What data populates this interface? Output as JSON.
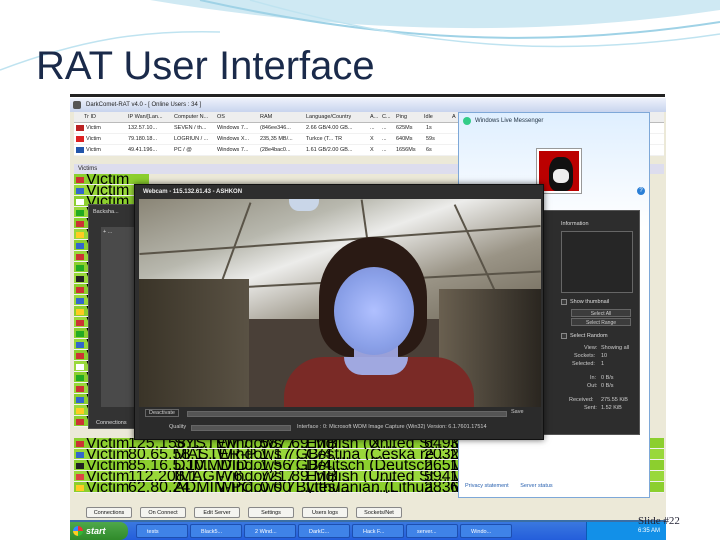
{
  "slide": {
    "title": "RAT User  Interface",
    "slide_number": "Slide #22"
  },
  "darkcomet": {
    "title": "DarkComet-RAT v4.0 - [ Online Users : 34 ]",
    "columns": [
      "Tr ID",
      "IP Wan/[Lan...",
      "Computer N...",
      "OS",
      "RAM",
      "Language/Country",
      "A...",
      "C...",
      "Ping",
      "Idle",
      "A"
    ],
    "top_rows": [
      {
        "id": "Victim",
        "ip": "132.57.10...",
        "pc": "SEVEN / th...",
        "os": "Windows 7...",
        "ram": "(846ee346...",
        "lang": "2.66 GB/4.00 GB...",
        "a": "...",
        "c": "...",
        "ping": "625Ms",
        "idle": "1s",
        "flag": "#b22"
      },
      {
        "id": "Victim",
        "ip": "79.180.18...",
        "pc": "LOGRIUN / ...",
        "os": "Windows X...",
        "ram": "235,35 MB/...",
        "lang": "Turkce (T... TR",
        "a": "X",
        "c": "...",
        "ping": "640Ms",
        "idle": "59s",
        "flag": "#d22"
      },
      {
        "id": "Victim",
        "ip": "49.41.196...",
        "pc": "PC / @",
        "os": "Windows 7...",
        "ram": "(28e4bac0...",
        "lang": "1.61 GB/2.00 GB...",
        "a": "X",
        "c": "...",
        "ping": "1656Ms",
        "idle": "6s",
        "flag": "#25a"
      }
    ],
    "victims_label": "Victims",
    "green_rows": [
      "Victim",
      "Victim",
      "Victim",
      "Victim",
      "Victim",
      "Victim",
      "Victim",
      "Victim",
      "Victim",
      "Victim",
      "Victim",
      "Victim",
      "Victim",
      "Victim",
      "Victim",
      "Victim",
      "Victim",
      "Victim",
      "Victim",
      "Victim",
      "Victim",
      "Victim",
      "Victim"
    ],
    "lower_rows": [
      {
        "id": "Victim",
        "ip": "125.158.1...",
        "pc": "SYSTEM / ...",
        "os": "Windows 7...",
        "ram": "587.69 MB...",
        "lang": "English (United St...",
        "a": "X",
        "c": "...",
        "ping": "649Ms",
        "idle": "3s"
      },
      {
        "id": "Victim",
        "ip": "80.65.58.1...",
        "pc": "MASTER-P...",
        "os": "Windows 7...",
        "ram": "1,17 GB/4,...",
        "lang": "Čeština (Česká re...",
        "a": "...",
        "c": "...",
        "ping": "203Ms",
        "idle": "2s"
      },
      {
        "id": "Victim",
        "ip": "85.16.5.10...",
        "pc": "DJMMDID...",
        "os": "Windows 7...",
        "ram": "1,56 GB/4,...",
        "lang": "Deutsch (Deutsch...",
        "a": "...",
        "c": "...",
        "ping": "265Ms",
        "idle": "1613s"
      },
      {
        "id": "Victim",
        "ip": "112.208.1...",
        "pc": "IMAGI-76...",
        "os": "Windows 7...",
        "ram": "721.89 MB...",
        "lang": "English (United St...",
        "a": "...",
        "c": "...",
        "ping": "594Ms",
        "idle": "11s"
      },
      {
        "id": "Victim",
        "ip": "62.80.24...",
        "pc": "ADMIN-PC...",
        "os": "Windows 7...",
        "ram": "0.00 Bytes/...",
        "lang": "Lithuanian (Lithua...",
        "a": "...",
        "c": "...",
        "ping": "283Ms",
        "idle": "6s"
      }
    ],
    "buttons": [
      "Connections",
      "On Connect",
      "Edit Server",
      "Settings",
      "Users logs",
      "Sockets/Net"
    ]
  },
  "backshell": {
    "title": "Backsha...",
    "tree_item": "+ ...",
    "connections_label": "Connections"
  },
  "webcam": {
    "title": "Webcam - 115.132.61.43 - ASHKON",
    "deactivate_label": "Deactivate",
    "quality_label": "Quality",
    "save_label": "Save",
    "interface_text": "Interface : 0: Microsoft WDM Image Capture (Win32) Version: 6.1.7601.17514"
  },
  "messenger": {
    "title": "Windows Live Messenger",
    "help": "?",
    "footer": [
      "Privacy statement",
      "Server status"
    ]
  },
  "panel": {
    "information_label": "Information",
    "show_thumbnail": "Show thumbnail",
    "select_all": "Select All",
    "select_range": "Select Range",
    "select_random": "Select Random",
    "view_label": "View:",
    "view_value": "Showing all",
    "sockets_label": "Sockets:",
    "sockets_value": "10",
    "selected_label": "Selected:",
    "selected_value": "1",
    "in_label": "In:",
    "in_value": "0 B/s",
    "out_label": "Out:",
    "out_value": "0 B/s",
    "received_label": "Received:",
    "received_value": "275.55 KiB",
    "sent_label": "Sent:",
    "sent_value": "1.52 KiB"
  },
  "taskbar": {
    "start_label": "start",
    "items": [
      "tests",
      "Black5...",
      "2 Wind...",
      "DarkC...",
      "Hack F...",
      "server...",
      "Windo..."
    ],
    "time": "6:35 AM"
  }
}
